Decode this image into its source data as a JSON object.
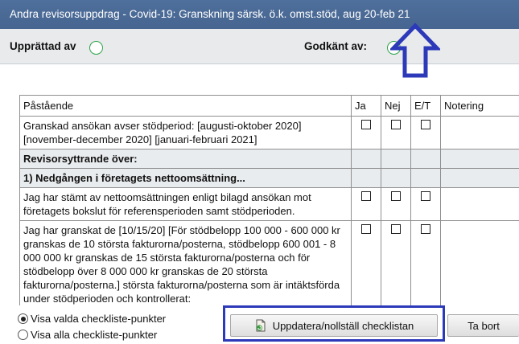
{
  "window": {
    "title": "Andra revisorsuppdrag - Covid-19: Granskning särsk. ö.k. omst.stöd, aug 20-feb 21"
  },
  "header": {
    "prepared_by_label": "Upprättad av",
    "approved_by_label": "Godkänt av:"
  },
  "table": {
    "columns": [
      "Påstående",
      "Ja",
      "Nej",
      "E/T",
      "Notering"
    ],
    "rows": [
      {
        "type": "item",
        "text": "Granskad ansökan avser stödperiod: [augusti-oktober 2020] [november-december 2020] [januari-februari 2021]"
      },
      {
        "type": "section",
        "text": "Revisorsyttrande över:"
      },
      {
        "type": "section",
        "text": "1) Nedgången i företagets nettoomsättning..."
      },
      {
        "type": "item",
        "text": "Jag har stämt av nettoomsättningen enligt bilagd ansökan mot företagets bokslut för referensperioden samt stödperioden."
      },
      {
        "type": "item",
        "text": "Jag har granskat de [10/15/20] [För stödbelopp 100 000 - 600 000 kr granskas de 10 största fakturorna/posterna, stödbelopp 600 001 - 8 000 000 kr granskas de 15 största fakturorna/posterna och för stödbelopp över 8 000 000 kr granskas de 20 största fakturorna/posterna.] största fakturorna/posterna som är intäktsförda under stödperioden och kontrollerat:"
      }
    ]
  },
  "filters": {
    "show_selected": "Visa valda checkliste-punkter",
    "show_all": "Visa alla checkliste-punkter",
    "selected": "show_selected"
  },
  "buttons": {
    "update_label": "Uppdatera/nollställ checklistan",
    "remove_label": "Ta bort"
  },
  "colors": {
    "titlebar": "#4a6a96",
    "status_circle": "#2ea34a",
    "annotation": "#2c39b8"
  },
  "icons": {
    "update_button": "document-refresh-icon",
    "annotation": "up-arrow-icon"
  }
}
